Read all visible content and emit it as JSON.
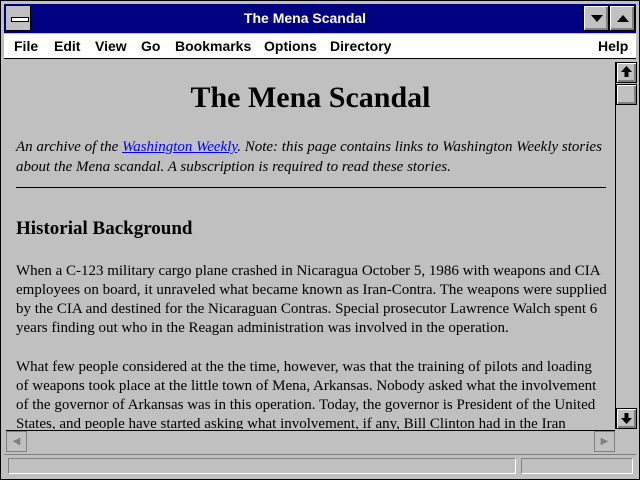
{
  "window": {
    "title": "The Mena Scandal"
  },
  "menubar": {
    "file": "File",
    "edit": "Edit",
    "view": "View",
    "go": "Go",
    "bookmarks": "Bookmarks",
    "options": "Options",
    "directory": "Directory",
    "help": "Help"
  },
  "page": {
    "heading": "The Mena Scandal",
    "intro_before_link": "An archive of the ",
    "intro_link": "Washington Weekly",
    "intro_after_link": ". Note: this page contains links to Washington Weekly stories about the Mena scandal. A subscription is required to read these stories.",
    "section_heading": "Historial Background",
    "paragraph1": "When a C-123 military cargo plane crashed in Nicaragua October 5, 1986 with weapons and CIA employees on board, it unraveled what became known as Iran-Contra. The weapons were supplied by the CIA and destined for the Nicaraguan Contras. Special prosecutor Lawrence Walch spent 6 years finding out who in the Reagan administration was involved in the operation.",
    "paragraph2": "What few people considered at the the time, however, was that the training of pilots and loading of weapons took place at the little town of Mena, Arkansas. Nobody asked what the involvement of the governor of Arkansas was in this operation. Today, the governor is President of the United States, and people have started asking what involvement, if any, Bill Clinton had in the Iran Contra"
  },
  "colors": {
    "titlebar": "#000080",
    "link": "#0000ff",
    "background": "#c0c0c0"
  },
  "icons": {
    "system_menu": "system-menu-icon",
    "minimize": "minimize-arrow-icon",
    "maximize": "maximize-arrow-icon",
    "scroll_up": "scroll-up-arrow-icon",
    "scroll_down": "scroll-down-arrow-icon",
    "scroll_left": "scroll-left-arrow-icon",
    "scroll_right": "scroll-right-arrow-icon"
  }
}
